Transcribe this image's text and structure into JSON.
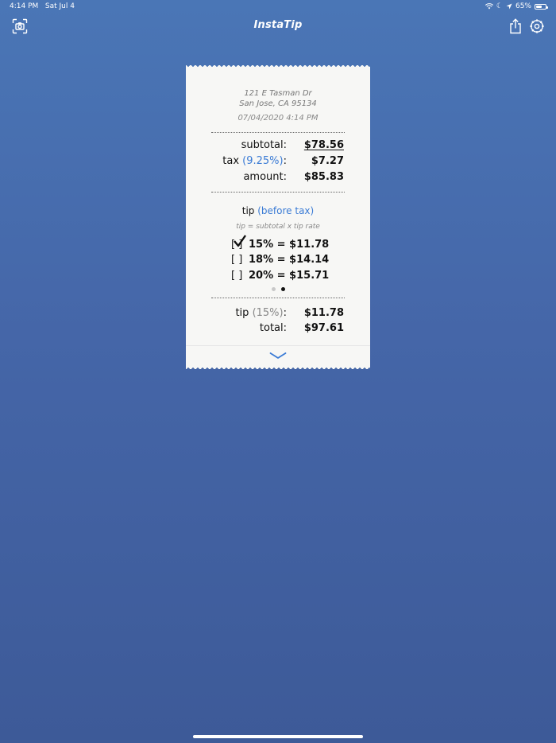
{
  "status_bar": {
    "time": "4:14 PM",
    "date": "Sat Jul 4",
    "battery": "65%",
    "battery_level": 0.65,
    "icons": [
      "wifi-icon",
      "moon-icon",
      "location-icon",
      "battery-icon"
    ]
  },
  "nav": {
    "title": "InstaTip",
    "left_icon": "camera-scan-icon",
    "right_icons": [
      "share-icon",
      "gear-icon"
    ]
  },
  "receipt": {
    "address_line1": "121 E Tasman Dr",
    "address_line2": "San Jose, CA 95134",
    "datetime": "07/04/2020 4:14 PM",
    "subtotal_label": "subtotal:",
    "subtotal_value": "$78.56",
    "tax_label": "tax",
    "tax_rate": "(9.25%)",
    "tax_colon": ":",
    "tax_value": "$7.27",
    "amount_label": "amount:",
    "amount_value": "$85.83",
    "tip_heading": "tip",
    "tip_mode": "(before tax)",
    "tip_formula": "tip = subtotal x tip rate",
    "tip_options": [
      {
        "box": "[ ]",
        "checked": true,
        "text": "15% = $11.78"
      },
      {
        "box": "[ ]",
        "checked": false,
        "text": "18% = $14.14"
      },
      {
        "box": "[ ]",
        "checked": false,
        "text": "20% = $15.71"
      }
    ],
    "page_dots": {
      "count": 2,
      "active": 1
    },
    "tip_summary_label": "tip",
    "tip_summary_rate": "(15%)",
    "tip_summary_colon": ":",
    "tip_summary_value": "$11.78",
    "total_label": "total:",
    "total_value": "$97.61",
    "expand_icon": "chevron-down-icon"
  },
  "colors": {
    "background_top": "#4a76b6",
    "background_bottom": "#3d5a98",
    "accent_blue": "#3a7bd5",
    "receipt_paper": "#f7f7f5"
  }
}
